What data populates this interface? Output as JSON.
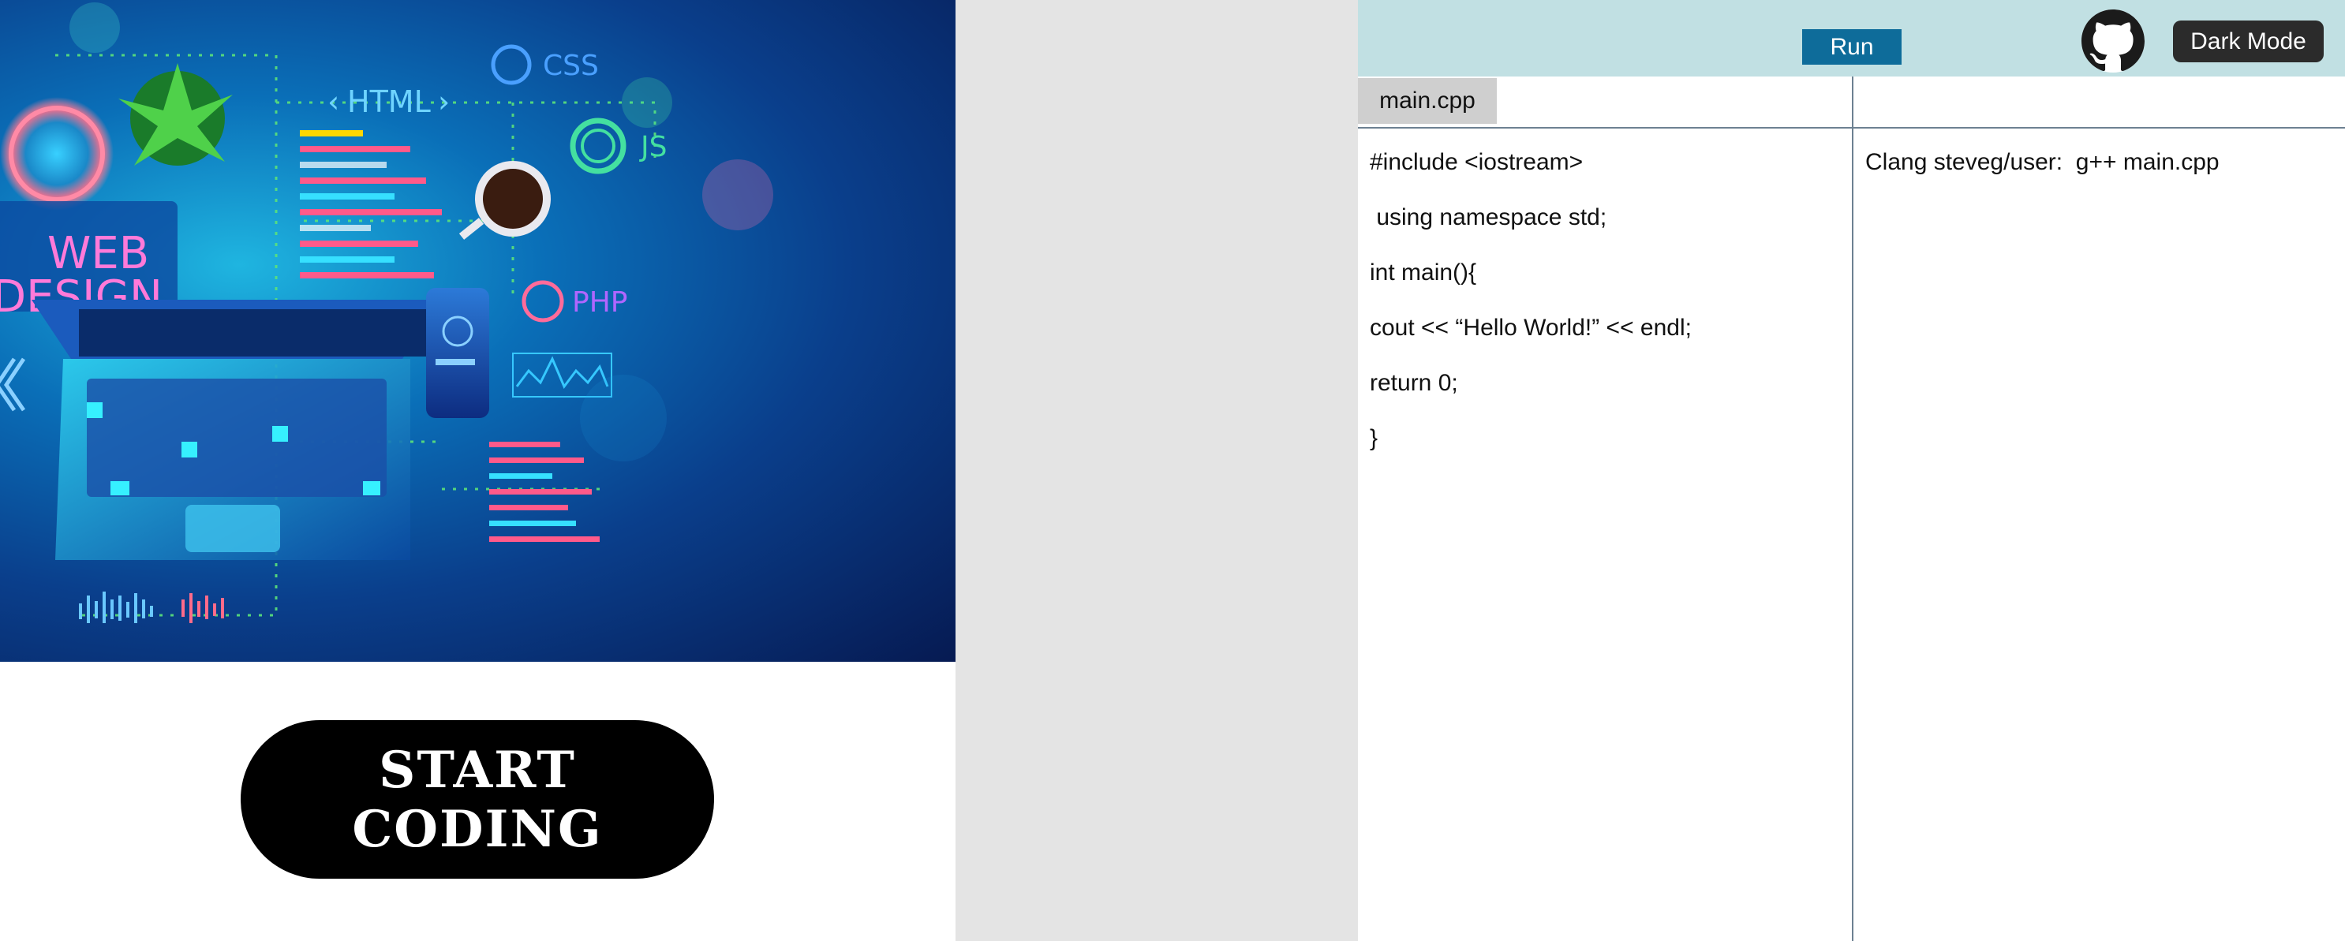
{
  "hero": {
    "labels": {
      "html": "HTML",
      "css": "CSS",
      "js": "JS",
      "php": "PHP",
      "web": "WEB",
      "design": "DESIGN"
    }
  },
  "start_button": {
    "label": "START CODING"
  },
  "toolbar": {
    "run_label": "Run",
    "dark_mode_label": "Dark Mode"
  },
  "editor": {
    "tab_label": "main.cpp",
    "code_lines": [
      "#include <iostream>",
      " using namespace std;",
      "int main(){",
      "cout << “Hello World!” << endl;",
      "return 0;",
      "}"
    ]
  },
  "terminal": {
    "text": "Clang steveg/user:  g++ main.cpp"
  },
  "colors": {
    "topbar": "#c1e0e3",
    "run_button": "#0e6c9a",
    "dark_button": "#2b2b2b",
    "start_button": "#000000",
    "gap": "#e4e4e4",
    "divider": "#6d8192"
  },
  "icons": {
    "github": "github-icon"
  }
}
